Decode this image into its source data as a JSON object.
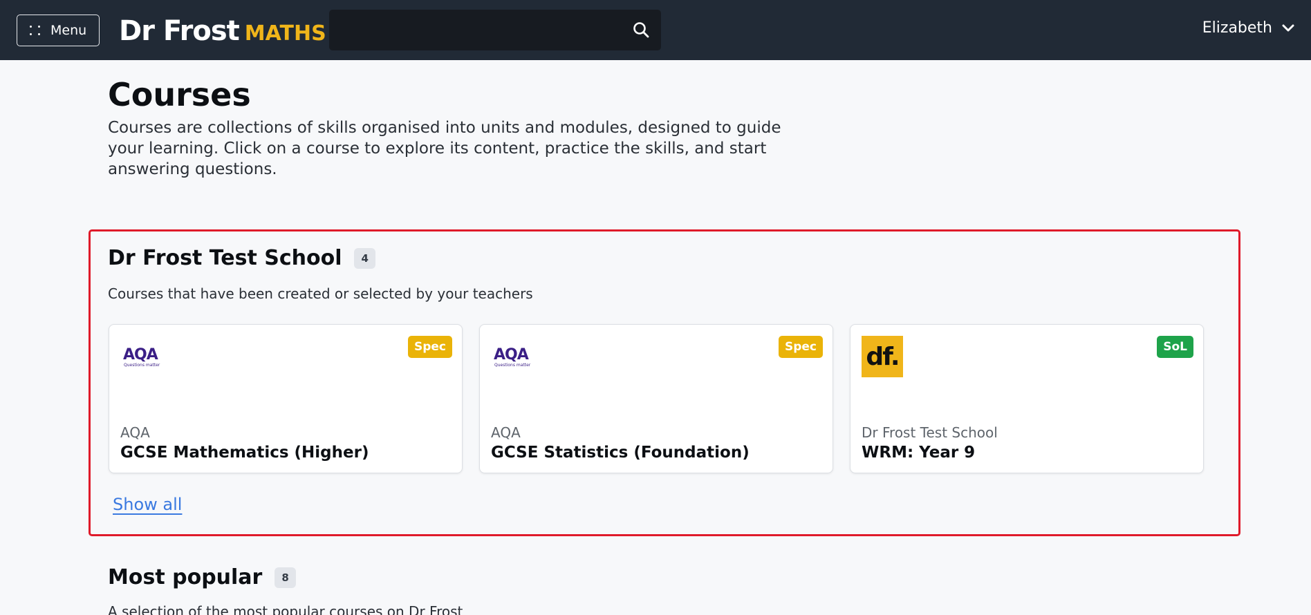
{
  "header": {
    "menu_label": "Menu",
    "logo_main": "Dr Frost",
    "logo_sub": "MATHS",
    "search_value": "",
    "user_name": "Elizabeth"
  },
  "page": {
    "title": "Courses",
    "description": "Courses are collections of skills organised into units and modules, designed to guide your learning. Click on a course to explore its content, practice the skills, and start answering questions."
  },
  "school_section": {
    "title": "Dr Frost Test School",
    "count": "4",
    "subtitle": "Courses that have been created or selected by your teachers",
    "show_all": "Show all",
    "cards": [
      {
        "badge": "Spec",
        "badge_color": "#eab308",
        "logo": "aqa-logo",
        "logo_text": "AQA",
        "logo_tagline": "Questions matter",
        "provider": "AQA",
        "name": "GCSE Mathematics (Higher)"
      },
      {
        "badge": "Spec",
        "badge_color": "#eab308",
        "logo": "aqa-logo",
        "logo_text": "AQA",
        "logo_tagline": "Questions matter",
        "provider": "AQA",
        "name": "GCSE Statistics (Foundation)"
      },
      {
        "badge": "SoL",
        "badge_color": "#1ea34a",
        "logo": "df-logo",
        "logo_text": "df.",
        "provider": "Dr Frost Test School",
        "name": "WRM: Year 9"
      }
    ]
  },
  "popular_section": {
    "title": "Most popular",
    "count": "8",
    "subtitle": "A selection of the most popular courses on Dr Frost"
  },
  "colors": {
    "header_bg": "#212a36",
    "accent_yellow": "#f0b51a",
    "highlight_border": "#df1a2a",
    "link_blue": "#3a79e0"
  }
}
